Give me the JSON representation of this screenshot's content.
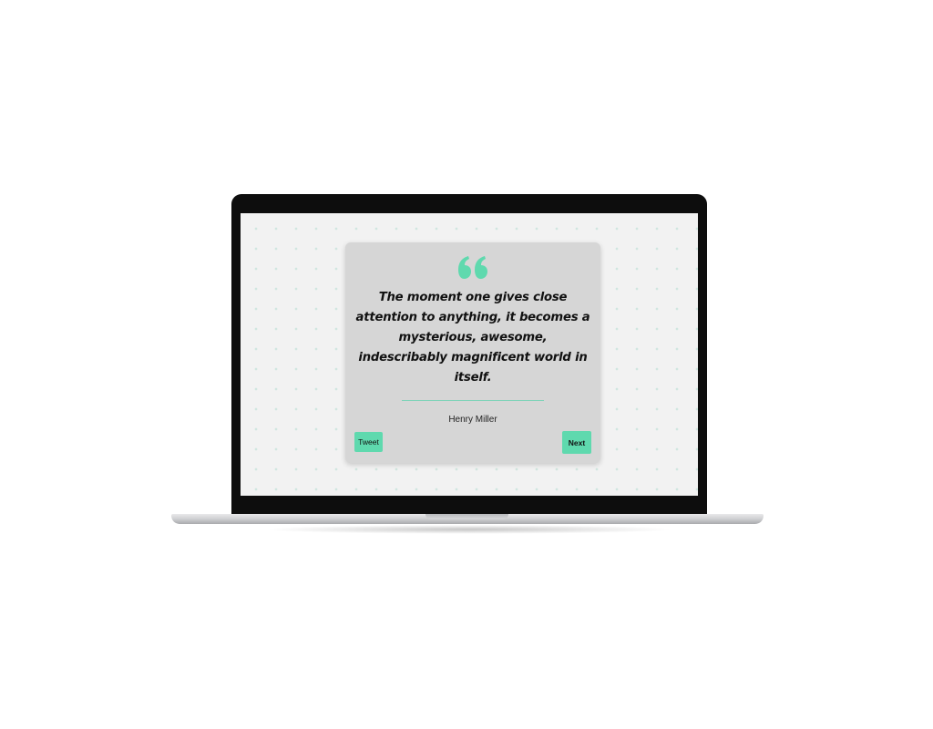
{
  "quote": {
    "text": "The moment one gives close attention to anything, it becomes a mysterious, awesome, indescribably magnificent world in itself.",
    "author": "Henry Miller",
    "icon": "quote-mark-icon"
  },
  "actions": {
    "tweet_label": "Tweet",
    "next_label": "Next"
  },
  "colors": {
    "accent": "#5fd9ae",
    "card_background": "#d6d6d6",
    "screen_background": "#f2f2f2",
    "bezel": "#0d0d0d"
  }
}
